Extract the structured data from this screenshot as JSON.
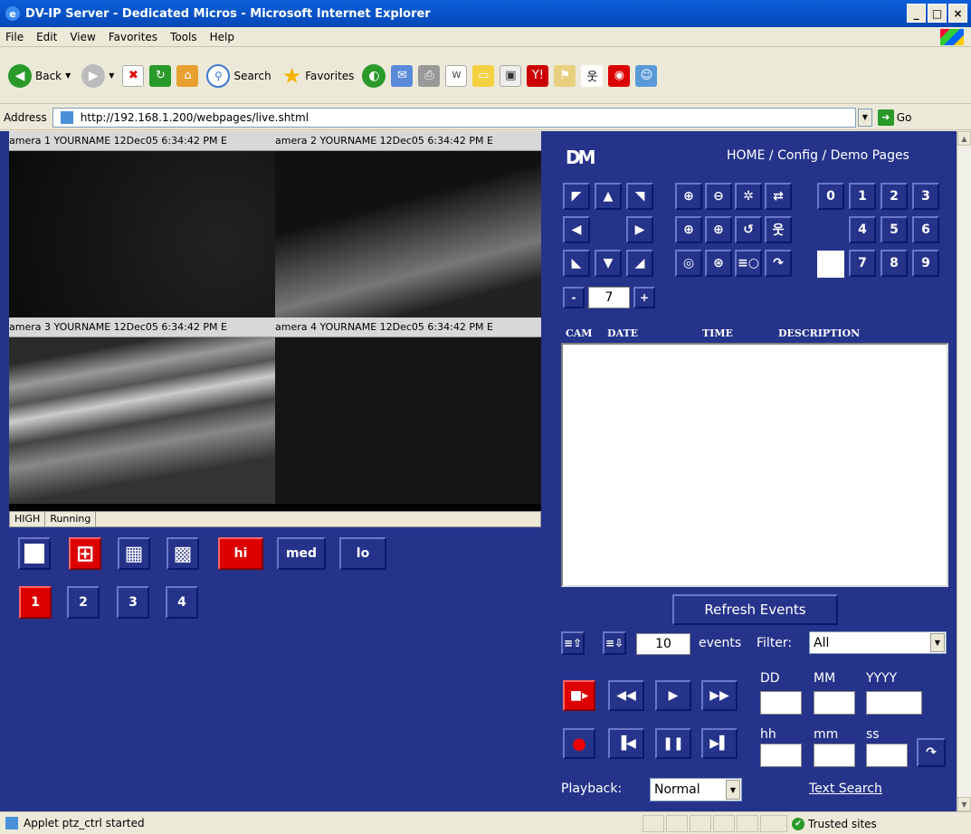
{
  "window": {
    "title": "DV-IP Server - Dedicated Micros - Microsoft Internet Explorer"
  },
  "menu": [
    "File",
    "Edit",
    "View",
    "Favorites",
    "Tools",
    "Help"
  ],
  "toolbar": {
    "back": "Back",
    "search": "Search",
    "favorites": "Favorites"
  },
  "address": {
    "label": "Address",
    "url": "http://192.168.1.200/webpages/live.shtml",
    "go": "Go"
  },
  "cameras": [
    {
      "label": "amera 1 YOURNAME 12Dec05 6:34:42 PM E"
    },
    {
      "label": "amera 2 YOURNAME 12Dec05 6:34:42 PM E"
    },
    {
      "label": "amera 3 YOURNAME 12Dec05 6:34:42 PM E"
    },
    {
      "label": "amera 4 YOURNAME 12Dec05 6:34:42 PM E"
    }
  ],
  "cam_status": {
    "quality": "HIGH",
    "state": "Running"
  },
  "view_buttons": {
    "hi": "hi",
    "med": "med",
    "lo": "lo"
  },
  "cam_select": [
    "1",
    "2",
    "3",
    "4"
  ],
  "header": {
    "logo": "DM",
    "nav": "HOME / Config / Demo Pages"
  },
  "presets": [
    "0",
    "1",
    "2",
    "3",
    "4",
    "5",
    "6",
    "7",
    "8",
    "9"
  ],
  "preset_step": {
    "minus": "-",
    "value": "7",
    "plus": "+"
  },
  "events": {
    "col_cam": "CAM",
    "col_date": "DATE",
    "col_time": "TIME",
    "col_desc": "DESCRIPTION",
    "refresh": "Refresh Events",
    "count": "10",
    "events_label": "events",
    "filter_label": "Filter:",
    "filter_value": "All"
  },
  "datetime": {
    "dd": "DD",
    "mm": "MM",
    "yyyy": "YYYY",
    "hh": "hh",
    "min": "mm",
    "ss": "ss"
  },
  "playback": {
    "label": "Playback:",
    "value": "Normal",
    "text_search": "Text Search"
  },
  "status": {
    "text": "Applet ptz_ctrl started",
    "zone": "Trusted sites"
  },
  "colors": {
    "page_bg": "#25338a",
    "accent_red": "#dd0000",
    "xp_title": "#0548b8"
  }
}
